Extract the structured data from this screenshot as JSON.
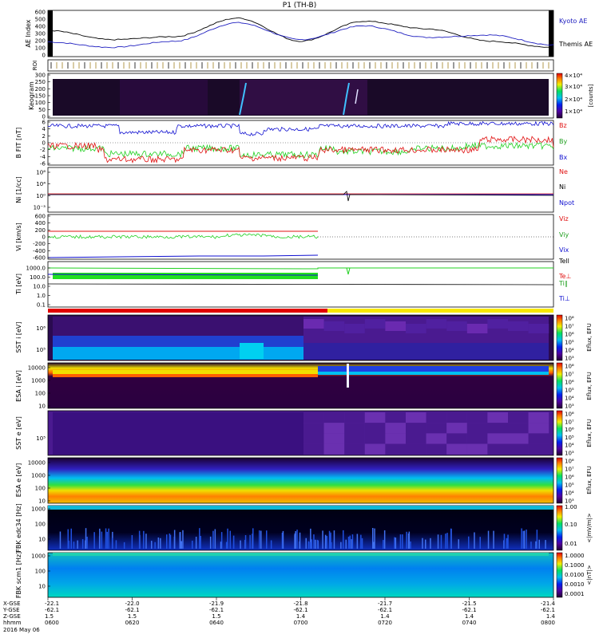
{
  "title": "P1 (TH-B)",
  "time_axis": {
    "labels": [
      "0600",
      "0620",
      "0640",
      "0700",
      "0720",
      "0740",
      "0800"
    ],
    "x_gse": [
      "-22.1",
      "-22.0",
      "-21.9",
      "-21.8",
      "-21.7",
      "-21.5",
      "-21.4"
    ],
    "y_gse": [
      "-62.1",
      "-62.1",
      "-62.1",
      "-62.1",
      "-62.1",
      "-62.1",
      "-62.1"
    ],
    "z_gse": [
      "1.5",
      "1.5",
      "1.5",
      "1.4",
      "1.4",
      "1.4",
      "1.4"
    ],
    "row_labels": [
      "X-GSE",
      "Y-GSE",
      "Z-GSE",
      "hhmm"
    ],
    "date": "2016 May 06"
  },
  "panels": {
    "ae": {
      "label": "AE Index",
      "ticks": [
        "600",
        "500",
        "400",
        "300",
        "200",
        "100",
        "0"
      ],
      "legend": [
        "Kyoto AE",
        "Themis AE"
      ]
    },
    "roi": {
      "label": "ROI"
    },
    "keogram": {
      "label": "Keogram",
      "ticks": [
        "300",
        "250",
        "200",
        "150",
        "100",
        "50",
        "0"
      ],
      "cbar_ticks": [
        "4×10⁴",
        "3×10⁴",
        "2×10⁴",
        "1×10⁴"
      ],
      "cbar_label": "[counts]"
    },
    "bfield": {
      "label": "B FIT [nT]",
      "ticks": [
        "6",
        "4",
        "2",
        "0",
        "-2",
        "-4",
        "-6"
      ],
      "legend": [
        "Bz",
        "By",
        "Bx"
      ]
    },
    "ni": {
      "label": "Ni [1/cc]",
      "ticks": [
        "10⁸",
        "10⁴",
        "10⁰",
        "10⁻³"
      ],
      "legend": [
        "Ne",
        "Ni",
        "Npot"
      ]
    },
    "vi": {
      "label": "Vi [km/s]",
      "ticks": [
        "600",
        "400",
        "200",
        "0",
        "-200",
        "-400",
        "-600"
      ],
      "legend": [
        "Viz",
        "Viy",
        "Vix"
      ]
    },
    "ti": {
      "label": "Ti [eV]",
      "ticks": [
        "1000.0",
        "100.0",
        "10.0",
        "1.0",
        "0.1"
      ],
      "legend": [
        "Tell",
        "Te⊥",
        "Ti∥",
        "Ti⊥"
      ]
    },
    "sst_i": {
      "label": "SST i [eV]",
      "ticks": [
        "10⁶",
        "10⁵"
      ],
      "cbar": [
        "10⁸",
        "10⁷",
        "10⁶",
        "10⁵",
        "10⁴",
        "10³"
      ],
      "cbar_label": "Eflux, EFU"
    },
    "esa_i": {
      "label": "ESA i [eV]",
      "ticks": [
        "10000",
        "1000",
        "100",
        "10"
      ],
      "cbar": [
        "10⁸",
        "10⁷",
        "10⁶",
        "10⁵",
        "10⁴",
        "10³"
      ],
      "cbar_label": "Eflux, EFU"
    },
    "sst_e": {
      "label": "SST e [eV]",
      "ticks": [
        "10⁵"
      ],
      "cbar": [
        "10⁸",
        "10⁷",
        "10⁶",
        "10⁵",
        "10⁴",
        "10³"
      ],
      "cbar_label": "Eflux, EFU"
    },
    "esa_e": {
      "label": "ESA e [eV]",
      "ticks": [
        "10000",
        "1000",
        "100",
        "10"
      ],
      "cbar": [
        "10⁸",
        "10⁷",
        "10⁶",
        "10⁵",
        "10⁴",
        "10³"
      ],
      "cbar_label": "Eflux, EFU"
    },
    "fbk_e": {
      "label": "FBK edc34 [Hz]",
      "ticks": [
        "1000",
        "100",
        "10"
      ],
      "cbar": [
        "1.00",
        "0.10",
        "0.01"
      ],
      "cbar_label": "<|mV/m|>"
    },
    "fbk_b": {
      "label": "FBK scm1 [Hz]",
      "ticks": [
        "1000",
        "100",
        "10"
      ],
      "cbar": [
        "1.0000",
        "0.1000",
        "0.0100",
        "0.0010",
        "0.0001"
      ],
      "cbar_label": "<|nT|>"
    }
  },
  "chart_data": {
    "type": "line",
    "title": "P1 (TH-B)",
    "x": [
      "0600",
      "0620",
      "0640",
      "0700",
      "0720",
      "0740",
      "0800"
    ],
    "series": [
      {
        "name": "Kyoto AE",
        "values": [
          190,
          120,
          200,
          440,
          220,
          400,
          250,
          280,
          150
        ]
      },
      {
        "name": "Themis AE",
        "values": [
          340,
          220,
          260,
          500,
          200,
          460,
          360,
          200,
          120
        ]
      }
    ],
    "ylabel": "AE Index",
    "ylim": [
      0,
      600
    ]
  },
  "colors": {
    "red": "#e01010",
    "green": "#20d020",
    "blue": "#1010d0",
    "ae_kyoto": "#2020c0",
    "ae_themis": "#000000",
    "mode_red": "#e00000",
    "mode_yellow": "#f8e800"
  }
}
